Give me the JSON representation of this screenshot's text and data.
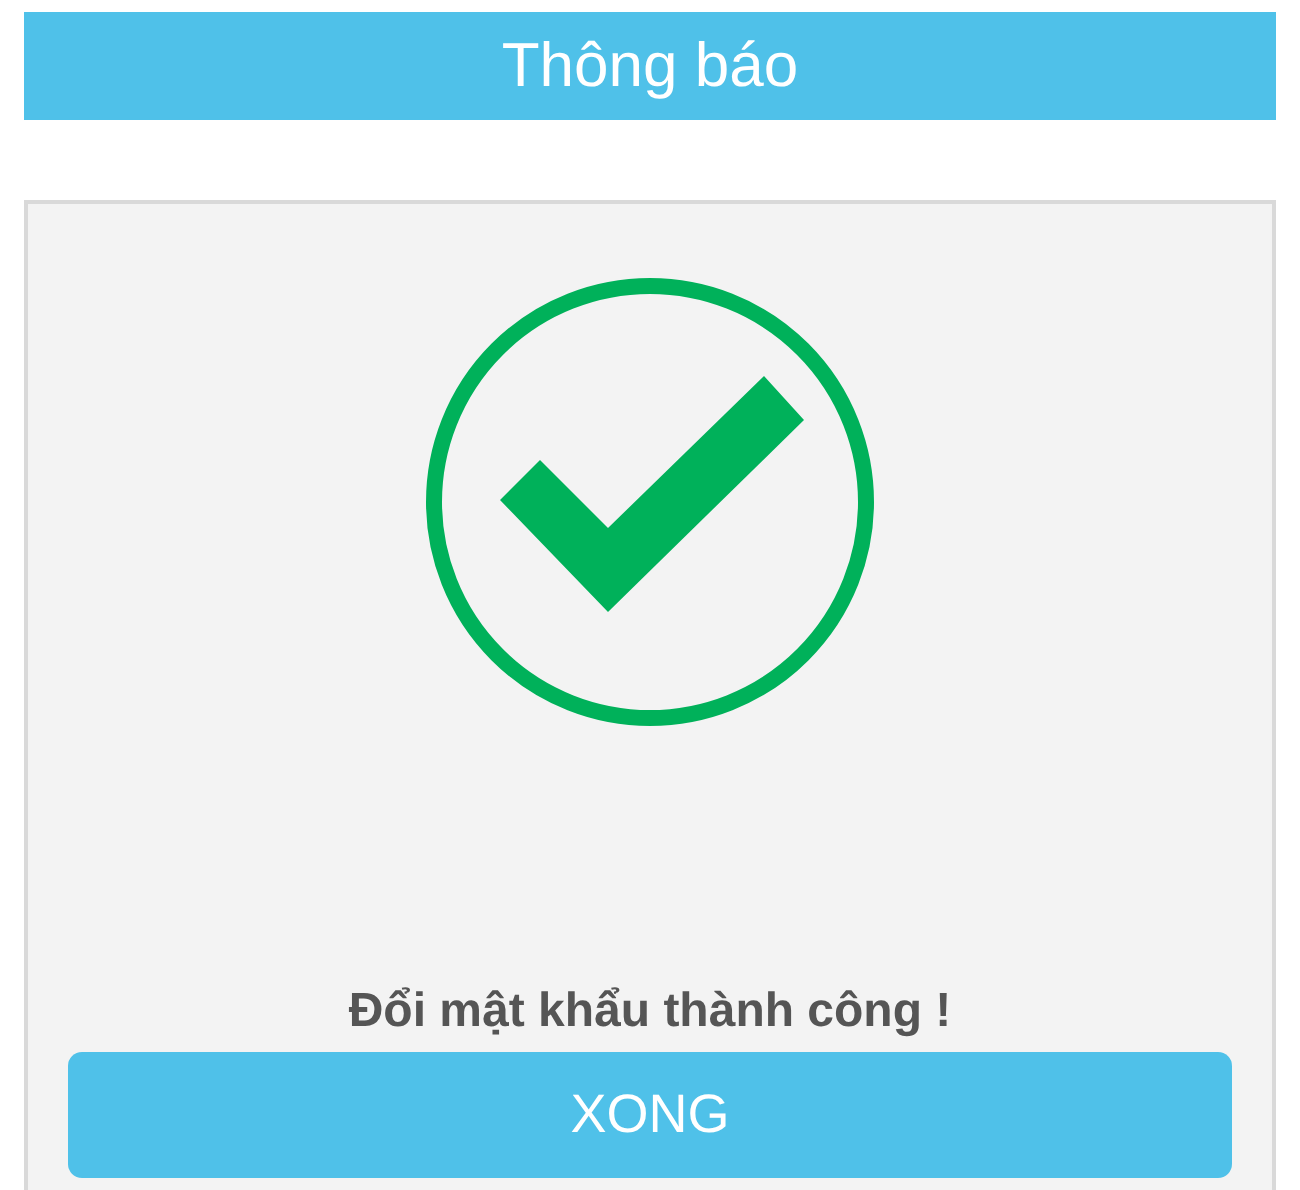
{
  "header": {
    "title": "Thông báo"
  },
  "message": "Đổi mật khẩu thành công !",
  "button": {
    "label": "XONG"
  }
}
